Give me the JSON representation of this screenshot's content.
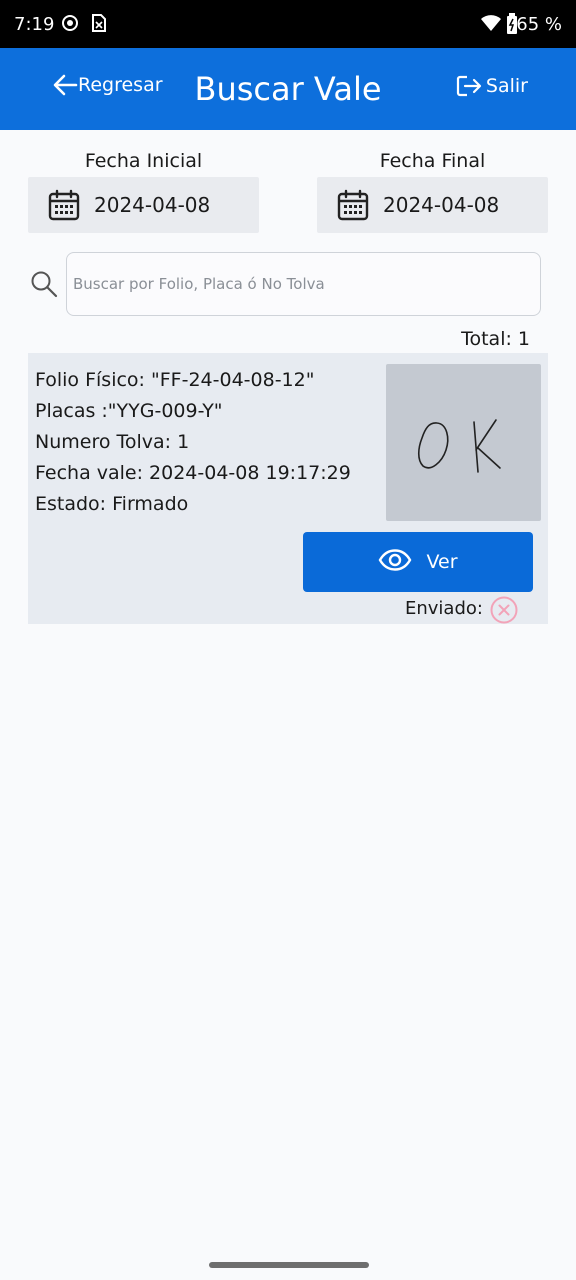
{
  "status_bar": {
    "time": "7:19",
    "battery": "65 %",
    "icons": [
      "record-icon",
      "sim-icon",
      "wifi-icon",
      "battery-icon"
    ]
  },
  "header": {
    "back_label": "Regresar",
    "title": "Buscar Vale",
    "logout_label": "Salir",
    "accent": "#0d6fdc"
  },
  "filters": {
    "start_label": "Fecha Inicial",
    "start_value": "2024-04-08",
    "end_label": "Fecha Final",
    "end_value": "2024-04-08"
  },
  "search": {
    "placeholder": "Buscar por Folio, Placa ó No Tolva",
    "value": ""
  },
  "results": {
    "total_text": "Total: 1",
    "items": [
      {
        "folio": "Folio Físico: \"FF-24-04-08-12\"",
        "placas": "Placas :\"YYG-009-Y\"",
        "tolva": "Numero Tolva: 1",
        "fecha": "Fecha vale:  2024-04-08 19:17:29",
        "estado": "Estado: Firmado",
        "signature_text": "OK",
        "view_label": "Ver",
        "sent_label": "Enviado:",
        "sent_status_color": "#f2a3b8"
      }
    ]
  }
}
